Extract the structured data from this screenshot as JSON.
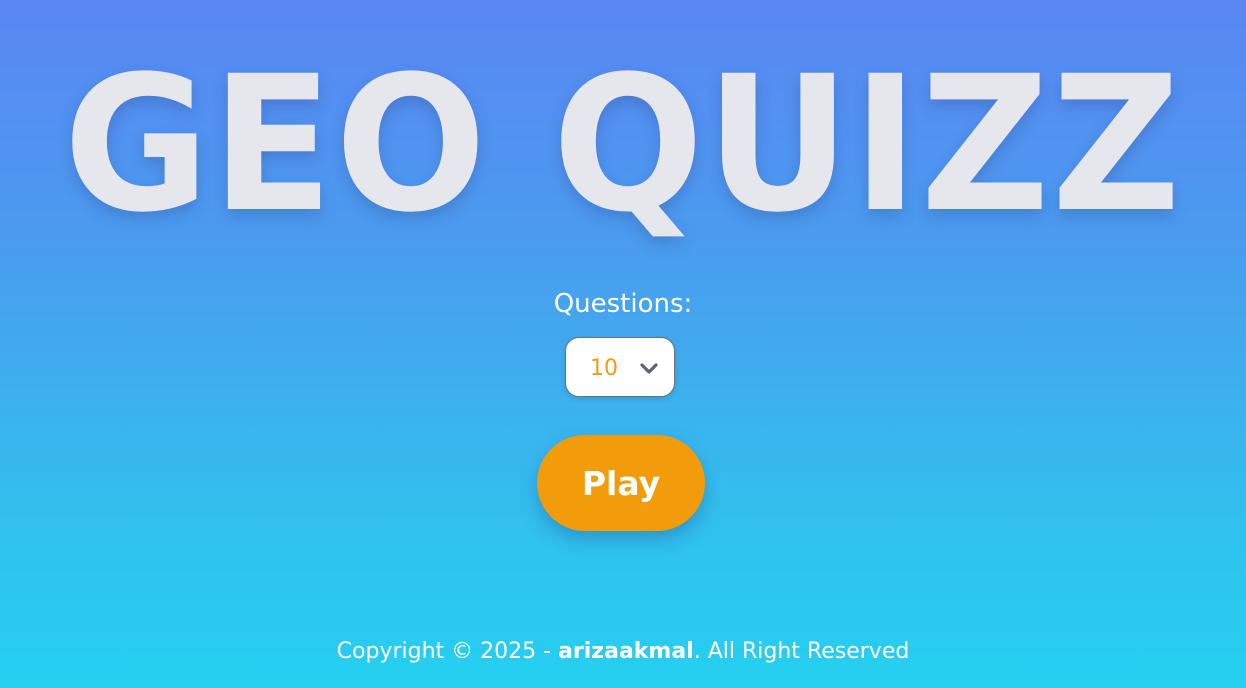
{
  "title": "GEO QUIZZ",
  "questions": {
    "label": "Questions:",
    "selected_value": "10",
    "chevron_icon": "chevron-down-icon"
  },
  "play_button": {
    "label": "Play"
  },
  "footer": {
    "prefix": "Copyright © 2025 - ",
    "author": "arizaakmal",
    "suffix": ". All Right Reserved"
  },
  "colors": {
    "accent": "#f39c0b",
    "title": "#e6e7ec",
    "background_top": "#5a87f3",
    "background_bottom": "#25d0f0"
  }
}
